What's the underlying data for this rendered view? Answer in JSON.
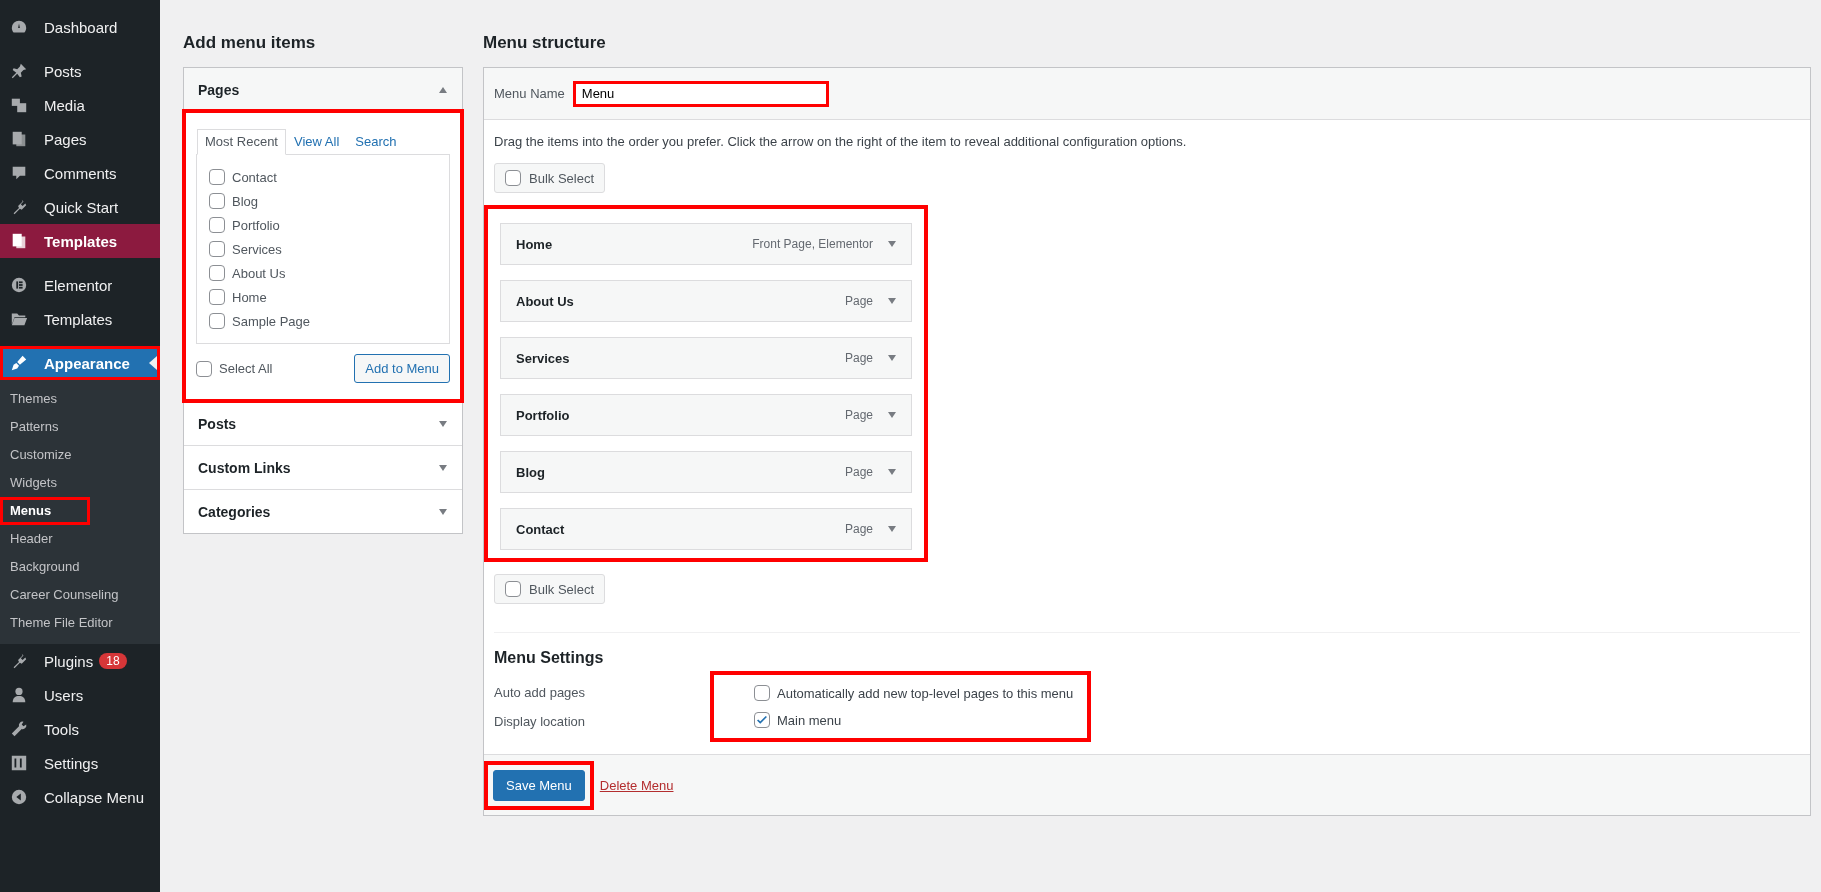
{
  "sidebar": {
    "groups": [
      [
        {
          "label": "Dashboard",
          "selected": false,
          "highlighted": false
        }
      ],
      [
        {
          "label": "Posts",
          "selected": false,
          "highlighted": false
        },
        {
          "label": "Media",
          "selected": false,
          "highlighted": false
        },
        {
          "label": "Pages",
          "selected": false,
          "highlighted": false
        },
        {
          "label": "Comments",
          "selected": false,
          "highlighted": false
        },
        {
          "label": "Quick Start",
          "selected": false,
          "highlighted": false
        },
        {
          "label": "Templates",
          "selected": true,
          "highlighted": false,
          "color": "#8c1a3f"
        }
      ],
      [
        {
          "label": "Elementor",
          "selected": false,
          "highlighted": false
        },
        {
          "label": "Templates",
          "selected": false,
          "highlighted": false
        }
      ],
      [
        {
          "label": "Appearance",
          "selected": true,
          "highlighted": true,
          "color": "#2271b1",
          "children": [
            {
              "label": "Themes",
              "selected": false,
              "highlighted": false
            },
            {
              "label": "Patterns",
              "selected": false,
              "highlighted": false
            },
            {
              "label": "Customize",
              "selected": false,
              "highlighted": false
            },
            {
              "label": "Widgets",
              "selected": false,
              "highlighted": false
            },
            {
              "label": "Menus",
              "selected": true,
              "highlighted": true
            },
            {
              "label": "Header",
              "selected": false,
              "highlighted": false
            },
            {
              "label": "Background",
              "selected": false,
              "highlighted": false
            },
            {
              "label": "Career Counseling",
              "selected": false,
              "highlighted": false
            },
            {
              "label": "Theme File Editor",
              "selected": false,
              "highlighted": false
            }
          ]
        },
        {
          "label": "Plugins",
          "selected": false,
          "highlighted": false,
          "badge": "18"
        },
        {
          "label": "Users",
          "selected": false,
          "highlighted": false
        },
        {
          "label": "Tools",
          "selected": false,
          "highlighted": false
        },
        {
          "label": "Settings",
          "selected": false,
          "highlighted": false
        },
        {
          "label": "Collapse Menu",
          "selected": false,
          "highlighted": false
        }
      ]
    ]
  },
  "add_menu_items": {
    "title": "Add menu items",
    "sections": [
      {
        "title": "Pages",
        "expanded": true,
        "highlighted": true,
        "tabs": [
          {
            "label": "Most Recent",
            "selected": true
          },
          {
            "label": "View All",
            "selected": false
          },
          {
            "label": "Search",
            "selected": false
          }
        ],
        "items": [
          {
            "label": "Contact",
            "checked": false
          },
          {
            "label": "Blog",
            "checked": false
          },
          {
            "label": "Portfolio",
            "checked": false
          },
          {
            "label": "Services",
            "checked": false
          },
          {
            "label": "About Us",
            "checked": false
          },
          {
            "label": "Home",
            "checked": false
          },
          {
            "label": "Sample Page",
            "checked": false
          }
        ],
        "select_all": {
          "label": "Select All",
          "checked": false
        },
        "button": "Add to Menu"
      },
      {
        "title": "Posts",
        "expanded": false
      },
      {
        "title": "Custom Links",
        "expanded": false
      },
      {
        "title": "Categories",
        "expanded": false
      }
    ]
  },
  "menu_structure": {
    "title": "Menu structure",
    "menu_name_label": "Menu Name",
    "menu_name": {
      "value": "Menu",
      "highlighted": true
    },
    "instructions": "Drag the items into the order you prefer. Click the arrow on the right of the item to reveal additional configuration options.",
    "bulk_select_top": {
      "label": "Bulk Select",
      "checked": false
    },
    "items_highlighted": true,
    "items": [
      {
        "title": "Home",
        "type": "Front Page, Elementor"
      },
      {
        "title": "About Us",
        "type": "Page"
      },
      {
        "title": "Services",
        "type": "Page"
      },
      {
        "title": "Portfolio",
        "type": "Page"
      },
      {
        "title": "Blog",
        "type": "Page"
      },
      {
        "title": "Contact",
        "type": "Page"
      }
    ],
    "bulk_select_bottom": {
      "label": "Bulk Select",
      "checked": false
    },
    "settings": {
      "title": "Menu Settings",
      "options_highlighted": true,
      "rows": [
        {
          "label": "Auto add pages",
          "option": "Automatically add new top-level pages to this menu",
          "checked": false
        },
        {
          "label": "Display location",
          "option": "Main menu",
          "checked": true
        }
      ]
    },
    "save_button": {
      "label": "Save Menu",
      "highlighted": true
    },
    "delete_link": "Delete Menu"
  }
}
